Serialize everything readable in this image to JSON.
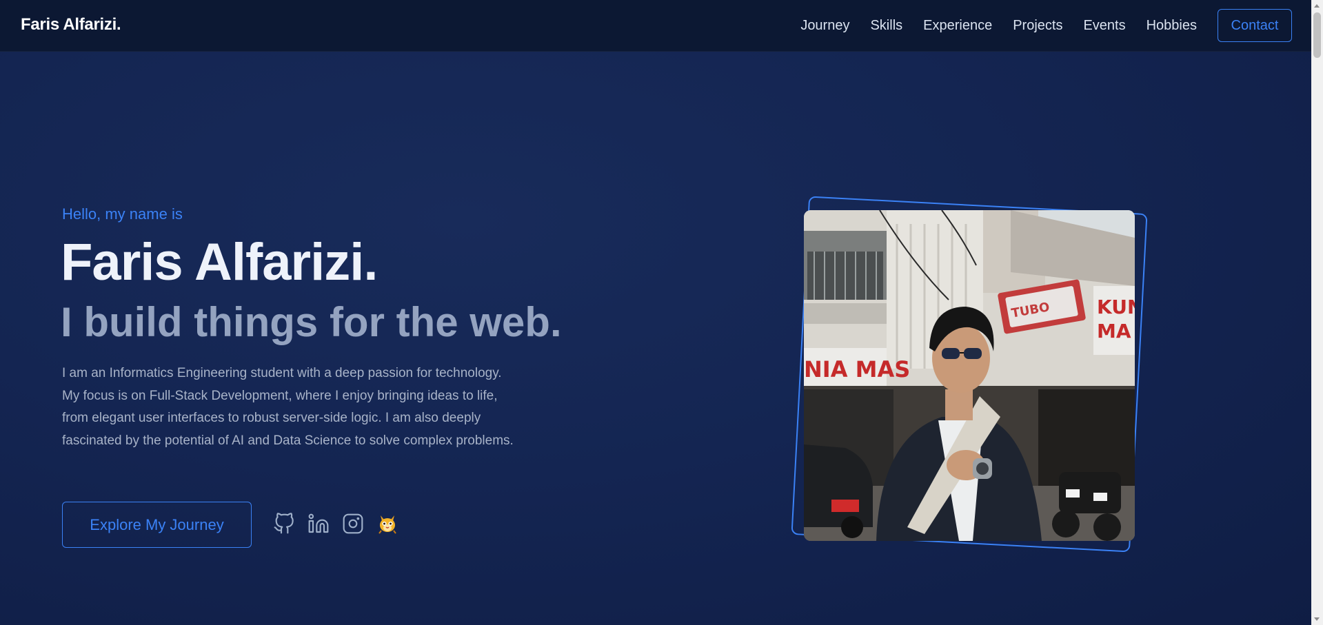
{
  "nav": {
    "brand": "Faris Alfarizi.",
    "links": [
      "Journey",
      "Skills",
      "Experience",
      "Projects",
      "Events",
      "Hobbies"
    ],
    "contact_label": "Contact"
  },
  "hero": {
    "greeting": "Hello, my name is",
    "name": "Faris Alfarizi.",
    "tagline": "I build things for the web.",
    "description": "I am an Informatics Engineering student with a deep passion for technology. My focus is on Full-Stack Development, where I enjoy bringing ideas to life, from elegant user interfaces to robust server-side logic. I am also deeply fascinated by the potential of AI and Data Science to solve complex problems.",
    "cta_label": "Explore My Journey",
    "socials": [
      "github-icon",
      "linkedin-icon",
      "instagram-icon",
      "mascot-icon"
    ]
  },
  "photo": {
    "storefront_sign_left": "NIA MAS",
    "storefront_sign_right": "KUN MA"
  },
  "colors": {
    "accent": "#3b82f6",
    "background": "#142552",
    "navbar": "#0c1833",
    "heading": "#eef2fa",
    "muted": "#94a3c0"
  }
}
